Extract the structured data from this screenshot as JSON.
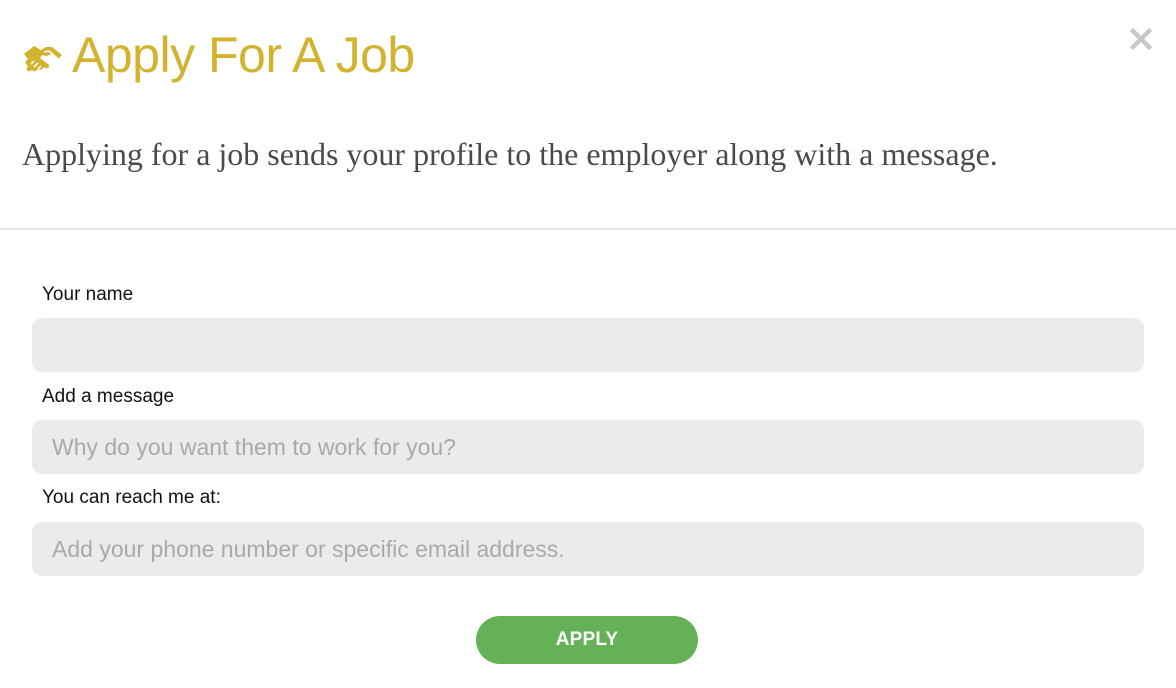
{
  "dialog": {
    "title": "Apply For A Job",
    "title_icon": "handshake-icon",
    "close_icon": "close-icon",
    "subtitle": "Applying for a job sends your profile to the employer along with a message.",
    "accent_color": "#d3b22e"
  },
  "form": {
    "name": {
      "label": "Your name",
      "value": "",
      "placeholder": ""
    },
    "message": {
      "label": "Add a message",
      "value": "",
      "placeholder": "Why do you want them to work for you?"
    },
    "contact": {
      "label": "You can reach me at:",
      "value": "",
      "placeholder": "Add your phone number or specific email address."
    },
    "submit_label": "APPLY",
    "submit_color": "#64b157"
  }
}
